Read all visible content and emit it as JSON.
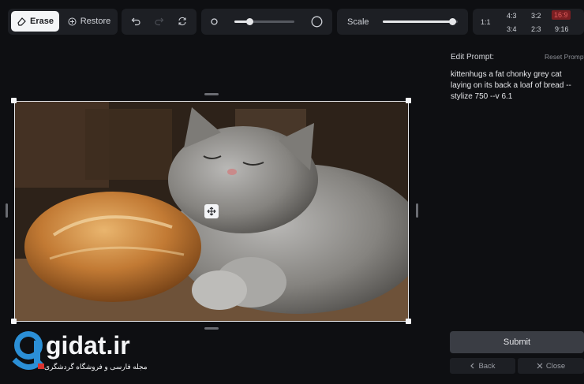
{
  "toolbar": {
    "erase_label": "Erase",
    "restore_label": "Restore",
    "scale_label": "Scale",
    "brush_level": 0.25,
    "scale_level": 0.93,
    "ratios": [
      "1:1",
      "4:3",
      "3:2",
      "16:9",
      "3:4",
      "2:3",
      "9:16"
    ],
    "active_ratio": "16:9",
    "active_ratio_color": "#7a1f22"
  },
  "canvas": {
    "image": "photo of a fat grey cat sleeping next to a loaf of bread",
    "move_icon": "move-arrows-icon"
  },
  "prompt_panel": {
    "label": "Edit Prompt:",
    "reset": "Reset Prompt",
    "text": "kittenhugs a fat chonky grey cat laying on its back a loaf of bread --stylize 750 --v 6.1"
  },
  "actions": {
    "submit": "Submit",
    "back": "Back",
    "close": "Close"
  },
  "watermark": {
    "brand": "gidat.ir",
    "tagline": "مجله فارسی و فروشگاه گردشگری"
  },
  "colors": {
    "background": "#0e0f12",
    "panel": "#1d1f24",
    "brand_blue": "#2b8fd6"
  }
}
